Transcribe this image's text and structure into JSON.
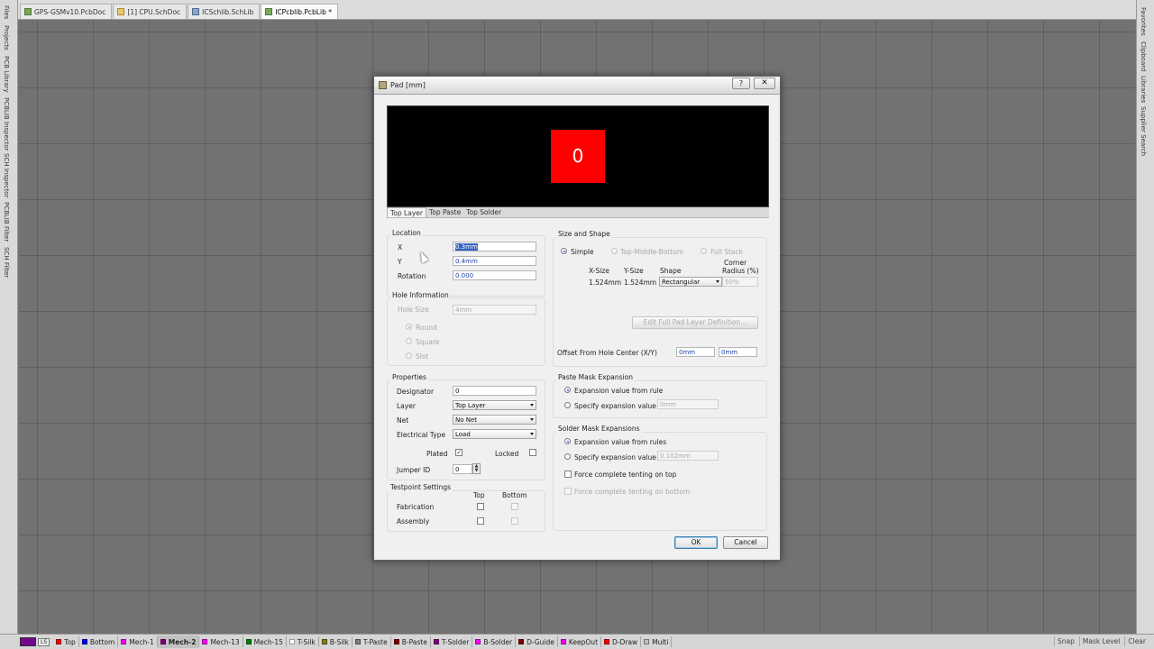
{
  "tabs": [
    {
      "label": "GPS-GSMv10.PcbDoc",
      "icon": "pcb-document-icon",
      "active": false
    },
    {
      "label": "[1] CPU.SchDoc",
      "icon": "schematic-document-icon",
      "active": false
    },
    {
      "label": "ICSchlib.SchLib",
      "icon": "schematic-library-icon",
      "active": false
    },
    {
      "label": "ICPcblib.PcbLib *",
      "icon": "pcb-library-icon",
      "active": true
    }
  ],
  "left_panels": [
    "Files",
    "Projects",
    "PCB Library",
    "PCBLIB Inspector",
    "SCH Inspector",
    "PCBLIB Filter",
    "SCH Filter"
  ],
  "right_panels": [
    "Favorites",
    "Clipboard",
    "Libraries",
    "Supplier Search"
  ],
  "dialog": {
    "title": "Pad [mm]",
    "help_label": "?",
    "close_label": "✕",
    "preview": {
      "designator": "0",
      "pad_color": "#ff0000",
      "background": "#000000"
    },
    "layer_tabs": [
      "Top Layer",
      "Top Paste",
      "Top Solder"
    ],
    "location": {
      "title": "Location",
      "x_label": "X",
      "x_value": "0.3mm",
      "y_label": "Y",
      "y_value": "0.4mm",
      "rotation_label": "Rotation",
      "rotation_value": "0.000"
    },
    "hole": {
      "title": "Hole Information",
      "size_label": "Hole Size",
      "size_value": "4mm",
      "round": "Round",
      "square": "Square",
      "slot": "Slot"
    },
    "properties": {
      "title": "Properties",
      "designator_label": "Designator",
      "designator_value": "0",
      "layer_label": "Layer",
      "layer_value": "Top Layer",
      "net_label": "Net",
      "net_value": "No Net",
      "electrical_label": "Electrical Type",
      "electrical_value": "Load",
      "plated_label": "Plated",
      "plated_mark": "✓",
      "locked_label": "Locked",
      "jumper_label": "Jumper ID",
      "jumper_value": "0",
      "spin_up": "▲",
      "spin_down": "▼"
    },
    "testpoint": {
      "title": "Testpoint Settings",
      "top_header": "Top",
      "bottom_header": "Bottom",
      "fabrication_label": "Fabrication",
      "assembly_label": "Assembly"
    },
    "size_shape": {
      "title": "Size and Shape",
      "simple": "Simple",
      "top_middle_bottom": "Top-Middle-Bottom",
      "full_stack": "Full Stack",
      "x_size_header": "X-Size",
      "y_size_header": "Y-Size",
      "shape_header": "Shape",
      "corner_header_1": "Corner",
      "corner_header_2": "Radius (%)",
      "x_size_value": "1.524mm",
      "y_size_value": "1.524mm",
      "shape_value": "Rectangular",
      "corner_value": "50%",
      "edit_button": "Edit Full Pad Layer Definition...",
      "offset_label": "Offset From Hole Center (X/Y)",
      "offset_x": "0mm",
      "offset_y": "0mm"
    },
    "paste_mask": {
      "title": "Paste Mask Expansion",
      "from_rule": "Expansion value from rule",
      "specify": "Specify expansion value",
      "value": "0mm"
    },
    "solder_mask": {
      "title": "Solder Mask Expansions",
      "from_rules": "Expansion value from rules",
      "specify": "Specify expansion value",
      "value": "0.102mm",
      "tent_top": "Force complete tenting on top",
      "tent_bottom": "Force complete tenting on bottom"
    },
    "ok_label": "OK",
    "cancel_label": "Cancel"
  },
  "layer_bar": {
    "current_color": "#72088a",
    "ls_label": "LS",
    "layers": [
      {
        "name": "Top",
        "color": "#ff0000",
        "active": false
      },
      {
        "name": "Bottom",
        "color": "#0000ff",
        "active": false
      },
      {
        "name": "Mech-1",
        "color": "#ff00ff",
        "active": false
      },
      {
        "name": "Mech-2",
        "color": "#800080",
        "active": true
      },
      {
        "name": "Mech-13",
        "color": "#ff00ff",
        "active": false
      },
      {
        "name": "Mech-15",
        "color": "#008000",
        "active": false
      },
      {
        "name": "T-Silk",
        "color": "#ffffff",
        "active": false
      },
      {
        "name": "B-Silk",
        "color": "#808000",
        "active": false
      },
      {
        "name": "T-Paste",
        "color": "#808080",
        "active": false
      },
      {
        "name": "B-Paste",
        "color": "#800000",
        "active": false
      },
      {
        "name": "T-Solder",
        "color": "#800080",
        "active": false
      },
      {
        "name": "B-Solder",
        "color": "#ff00ff",
        "active": false
      },
      {
        "name": "D-Guide",
        "color": "#800000",
        "active": false
      },
      {
        "name": "KeepOut",
        "color": "#ff00ff",
        "active": false
      },
      {
        "name": "D-Draw",
        "color": "#ff0000",
        "active": false
      },
      {
        "name": "Multi",
        "color": "#c0c0c0",
        "active": false
      }
    ],
    "right_buttons": [
      "Snap",
      "Mask Level",
      "Clear"
    ]
  }
}
